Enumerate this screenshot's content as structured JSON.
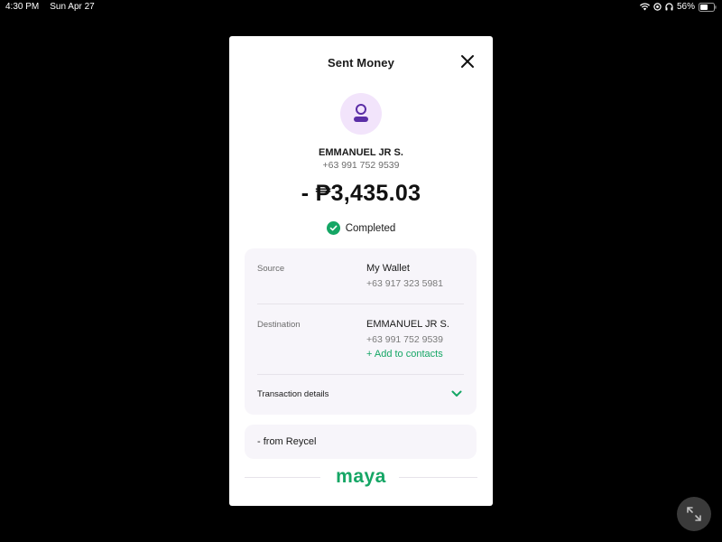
{
  "status_bar": {
    "time": "4:30 PM",
    "date": "Sun Apr 27",
    "battery": "56%",
    "icons": [
      "wifi-icon",
      "location-icon",
      "headphones-icon",
      "battery-icon"
    ]
  },
  "modal": {
    "title": "Sent Money",
    "close_icon": "close-icon"
  },
  "recipient": {
    "avatar_icon": "person-icon",
    "name": "EMMANUEL JR S.",
    "phone": "+63 991 752 9539"
  },
  "transaction": {
    "amount": "- ₱3,435.03",
    "status": "Completed",
    "status_icon": "check-circle-icon"
  },
  "details": {
    "source_label": "Source",
    "source_value": "My Wallet",
    "source_phone": "+63 917 323 5981",
    "destination_label": "Destination",
    "destination_value": "EMMANUEL JR S.",
    "destination_phone": "+63 991 752 9539",
    "add_contact": "+ Add to contacts",
    "transaction_details_label": "Transaction details",
    "expand_icon": "chevron-down-icon"
  },
  "note": {
    "text": "- from Reycel"
  },
  "footer": {
    "brand": "maya"
  },
  "colors": {
    "accent": "#15a665",
    "avatar_bg": "#f2e4fb",
    "avatar_icon": "#5b2ea6",
    "card_bg": "#f7f5fa",
    "background": "#000000"
  },
  "floating": {
    "expand_icon": "expand-icon"
  }
}
